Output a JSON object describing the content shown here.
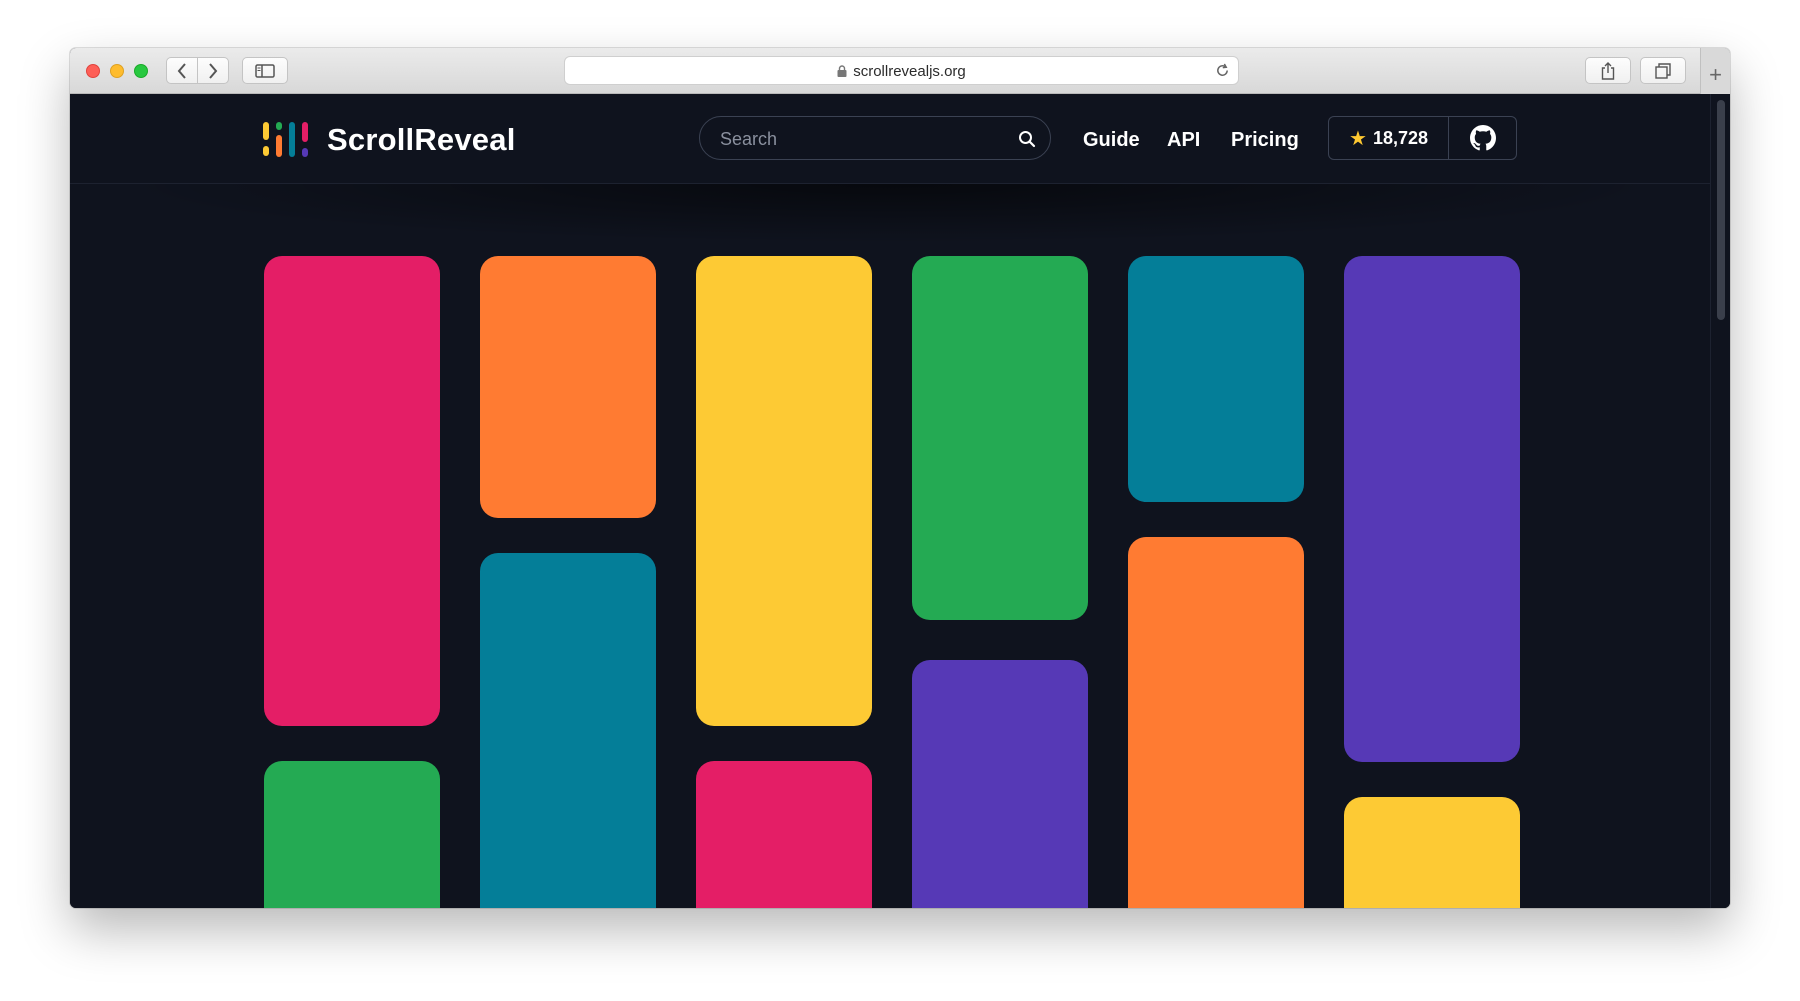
{
  "browser": {
    "url": "scrollrevealjs.org",
    "icons": [
      "back-icon",
      "forward-icon",
      "sidebar-icon",
      "lock-icon",
      "reload-icon",
      "share-icon",
      "tabs-icon",
      "plus-icon"
    ],
    "new_tab_glyph": "+"
  },
  "site": {
    "brand": "ScrollReveal",
    "search_placeholder": "Search",
    "nav": {
      "guide": "Guide",
      "api": "API",
      "pricing": "Pricing"
    },
    "github": {
      "star_glyph": "★",
      "stars": "18,728"
    },
    "colors": {
      "background": "#0f131e",
      "pink": "#e41e66",
      "orange": "#ff7b32",
      "yellow": "#fdca34",
      "green": "#24aa53",
      "teal": "#047e98",
      "purple": "#5639b6"
    },
    "tile_columns": [
      [
        "pink",
        "green"
      ],
      [
        "orange",
        "teal"
      ],
      [
        "yellow",
        "pink"
      ],
      [
        "green",
        "purple"
      ],
      [
        "teal",
        "orange"
      ],
      [
        "purple",
        "yellow"
      ]
    ]
  }
}
